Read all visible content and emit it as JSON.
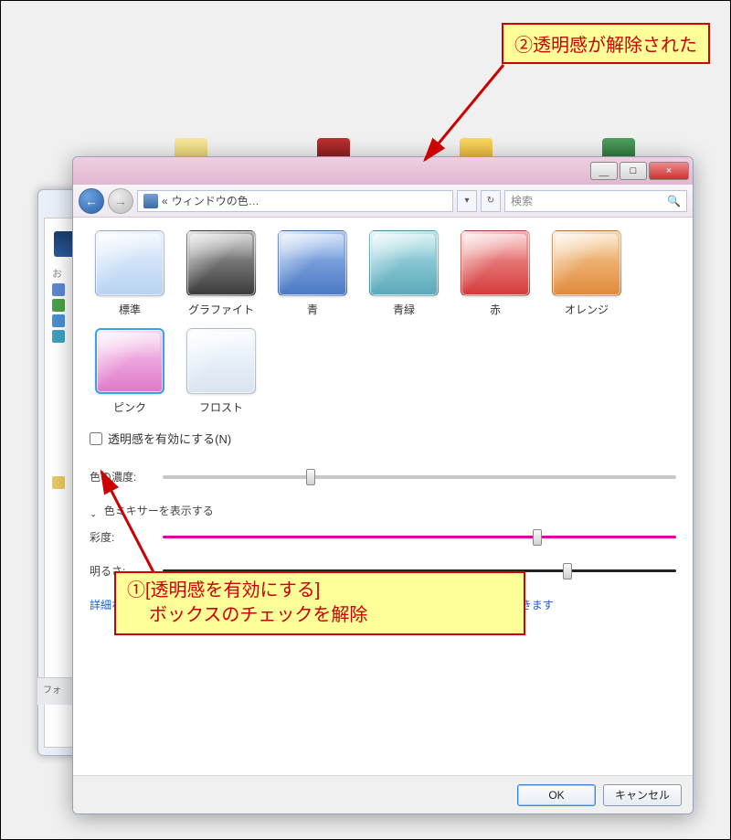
{
  "annotations": {
    "callout2": "②透明感が解除された",
    "callout1_line1": "①[透明感を有効にする]",
    "callout1_line2": "ボックスのチェックを解除"
  },
  "titlebar": {
    "min_glyph": "＿",
    "max_glyph": "□",
    "close_glyph": "×"
  },
  "navbar": {
    "back_glyph": "←",
    "fwd_glyph": "→",
    "breadcrumb_prefix": "«",
    "breadcrumb": "ウィンドウの色…",
    "dropdown_glyph": "▾",
    "refresh_glyph": "↻",
    "search_placeholder": "検索",
    "search_icon": "🔍"
  },
  "colors": [
    {
      "key": "standard",
      "label": "標準"
    },
    {
      "key": "graphite",
      "label": "グラファイト"
    },
    {
      "key": "blue",
      "label": "青"
    },
    {
      "key": "teal",
      "label": "青緑"
    },
    {
      "key": "red",
      "label": "赤"
    },
    {
      "key": "orange",
      "label": "オレンジ"
    },
    {
      "key": "pink",
      "label": "ピンク"
    },
    {
      "key": "frost",
      "label": "フロスト"
    }
  ],
  "checkbox": {
    "label": "透明感を有効にする(N)",
    "checked": false
  },
  "sliders": {
    "intensity_label": "色の濃度:",
    "mixer_label": "色ミキサーを表示する",
    "saturation_label": "彩度:",
    "brightness_label": "明るさ:"
  },
  "link": "詳細な色のオプションを設定するにはクラシック スタイルの [デザイン] プロパティを開きます",
  "buttons": {
    "ok": "OK",
    "cancel": "キャンセル"
  },
  "back_window": {
    "drive_hint": "お",
    "folder_label": "フォ"
  }
}
